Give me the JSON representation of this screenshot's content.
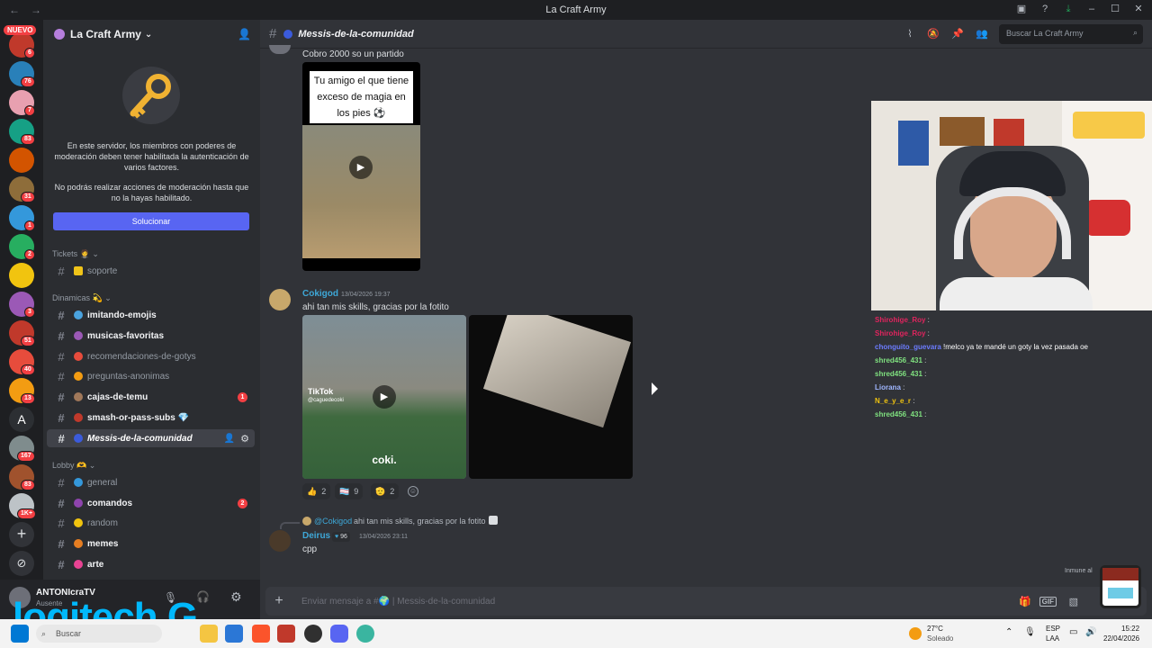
{
  "window": {
    "title": "La Craft Army",
    "nav_back": "←",
    "nav_fwd": "→"
  },
  "servers": {
    "new_badge": "NUEVO",
    "badges": [
      "6",
      "76",
      "7",
      "83",
      "31",
      "1",
      "2",
      "3",
      "51",
      "40",
      "13",
      "167",
      "83",
      "1K+"
    ]
  },
  "guild": {
    "name": "La Craft Army",
    "chevron": "⌄"
  },
  "moderation": {
    "text1": "En este servidor, los miembros con poderes de moderación deben tener habilitada la autenticación de varios factores.",
    "text2": "No podrás realizar acciones de moderación hasta que no la hayas habilitado.",
    "button": "Solucionar"
  },
  "categories": {
    "tickets": "Tickets 🤵 ⌄",
    "dinamicas": "Dinamicas 💫 ⌄",
    "lobby": "Lobby 🫶 ⌄"
  },
  "channels": [
    {
      "name": "soporte",
      "emoji_color": "#f0c419"
    },
    {
      "name": "imitando-emojis",
      "emoji_color": "#4aa3df"
    },
    {
      "name": "musicas-favoritas",
      "emoji_color": "#9b59b6"
    },
    {
      "name": "recomendaciones-de-gotys",
      "emoji_color": "#e74c3c"
    },
    {
      "name": "preguntas-anonimas",
      "emoji_color": "#f39c12"
    },
    {
      "name": "cajas-de-temu",
      "emoji_color": "#a0785a",
      "count": "1"
    },
    {
      "name": "smash-or-pass-subs 💎",
      "emoji_color": "#c0392b"
    },
    {
      "name": "Messis-de-la-comunidad",
      "emoji_color": "#3b5bdb"
    },
    {
      "name": "general",
      "emoji_color": "#3498db"
    },
    {
      "name": "comandos",
      "emoji_color": "#8e44ad",
      "count": "2"
    },
    {
      "name": "random",
      "emoji_color": "#f1c40f"
    },
    {
      "name": "memes",
      "emoji_color": "#e67e22"
    },
    {
      "name": "arte",
      "emoji_color": "#e84393"
    }
  ],
  "user": {
    "name": "ANTONIcraTV",
    "status": "Ausente"
  },
  "header": {
    "channel": "Messis-de-la-comunidad",
    "search_placeholder": "Buscar La Craft Army"
  },
  "messages": {
    "m1_text": "Cobro 2000 so un partido",
    "video1_caption": "Tu amigo el que tiene exceso de magia en los pies ⚽",
    "m2_author": "Cokigod",
    "m2_time": "13/04/2026 19:37",
    "m2_text": "ahi tan mis skills, gracias por la fotito",
    "tiktok_label": "TikTok",
    "tiktok_handle": "@caguedecoki",
    "video2_caption": "coki.",
    "reactions": [
      {
        "emoji": "👍",
        "count": "2"
      },
      {
        "emoji": "🏳️‍⚧️",
        "count": "9"
      },
      {
        "emoji": "🫡",
        "count": "2"
      }
    ],
    "reply_ref": "@Cokigod",
    "reply_text": "ahi tan mis skills, gracias por la fotito",
    "m3_author": "Deirus",
    "m3_badge": "96",
    "m3_time": "13/04/2026 23:11",
    "m3_text": "cpp"
  },
  "composer": {
    "placeholder": "Enviar mensaje a #🌍 | Messis-de-la-comunidad"
  },
  "overlay_chat": [
    {
      "user": "Shirohige_Roy",
      "color": "#e0245e",
      "msg": ""
    },
    {
      "user": "Shirohige_Roy",
      "color": "#e0245e",
      "msg": ""
    },
    {
      "user": "chonguito_guevara",
      "color": "#6c7cff",
      "msg": " !melco ya te mandé un goty la vez pasada oe"
    },
    {
      "user": "shred456_431",
      "color": "#7fe07f",
      "msg": ""
    },
    {
      "user": "shred456_431",
      "color": "#7fe07f",
      "msg": ""
    },
    {
      "user": "Liorana",
      "color": "#9fb6ff",
      "msg": ""
    },
    {
      "user": "N_e_y_e_r",
      "color": "#f1c40f",
      "msg": ""
    },
    {
      "user": "shred456_431",
      "color": "#7fe07f",
      "msg": ""
    }
  ],
  "overlay_footer": "Inmune al",
  "brand": {
    "logo": "logitech G"
  },
  "taskbar": {
    "search": "Buscar",
    "weather_temp": "27°C",
    "weather_desc": "Soleado",
    "lang1": "ESP",
    "lang2": "LAA",
    "time": "15:22",
    "date": "22/04/2026"
  }
}
